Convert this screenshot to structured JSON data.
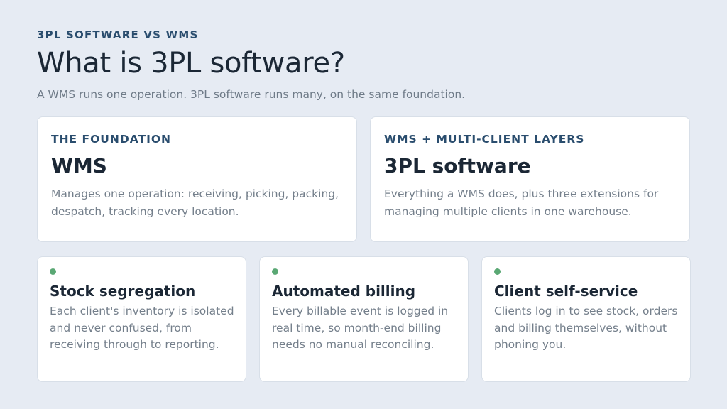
{
  "header": {
    "eyebrow": "3PL SOFTWARE VS WMS",
    "title": "What is 3PL software?",
    "subtitle": "A WMS runs one operation. 3PL software runs many, on the same foundation."
  },
  "cards": [
    {
      "label": "THE FOUNDATION",
      "heading": "WMS",
      "text": "Manages one operation: receiving, picking, packing, despatch, tracking every location."
    },
    {
      "label": "WMS + MULTI-CLIENT LAYERS",
      "heading": "3PL software",
      "text": "Everything a WMS does, plus three extensions for managing multiple clients in one warehouse."
    }
  ],
  "features": [
    {
      "icon": "green-dot-icon",
      "heading": "Stock segregation",
      "text": "Each client's inventory is isolated and never confused, from receiving through to reporting."
    },
    {
      "icon": "green-dot-icon",
      "heading": "Automated billing",
      "text": "Every billable event is logged in real time, so month-end billing needs no manual reconciling."
    },
    {
      "icon": "green-dot-icon",
      "heading": "Client self-service",
      "text": "Clients log in to see stock, orders and billing themselves, without phoning you."
    }
  ],
  "colors": {
    "background": "#e6ebf3",
    "accent_label": "#2a4d6e",
    "dot": "#5aa874"
  }
}
